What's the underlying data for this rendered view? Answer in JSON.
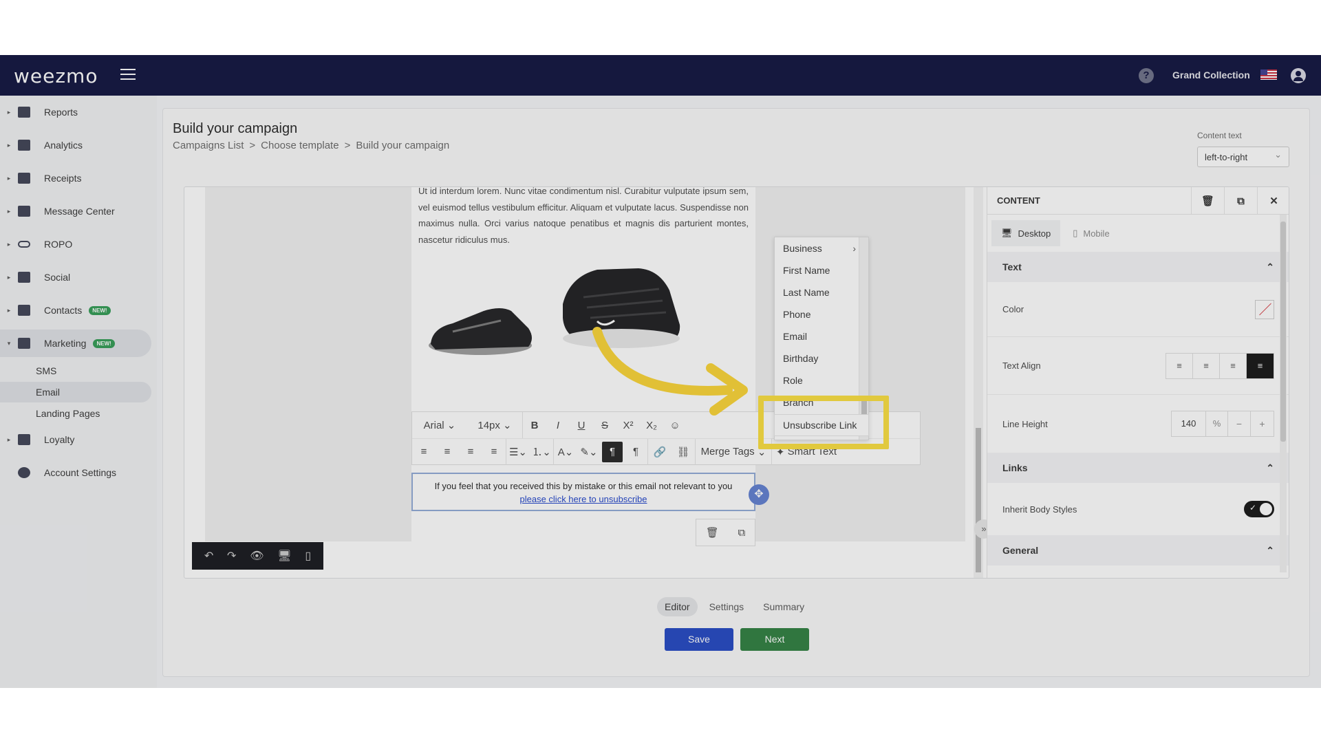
{
  "app": {
    "logo": "weezmo",
    "org_name": "Grand Collection"
  },
  "sidebar": {
    "items": [
      {
        "label": "Reports"
      },
      {
        "label": "Analytics"
      },
      {
        "label": "Receipts"
      },
      {
        "label": "Message Center"
      },
      {
        "label": "ROPO"
      },
      {
        "label": "Social"
      },
      {
        "label": "Contacts",
        "badge": "NEW!"
      },
      {
        "label": "Marketing",
        "badge": "NEW!"
      },
      {
        "label": "Loyalty"
      },
      {
        "label": "Account Settings"
      }
    ],
    "marketing_sub": [
      "SMS",
      "Email",
      "Landing Pages"
    ]
  },
  "page": {
    "title": "Build your campaign",
    "breadcrumb": [
      "Campaigns List",
      ">",
      "Choose template",
      ">",
      "Build your campaign"
    ],
    "content_text_label": "Content text",
    "content_text_value": "left-to-right"
  },
  "email": {
    "lorem": "Ut id interdum lorem. Nunc vitae condimentum nisl. Curabitur vulputate ipsum sem, vel euismod tellus vestibulum efficitur. Aliquam et vulputate lacus. Suspendisse non maximus nulla. Orci varius natoque penatibus et magnis dis parturient montes, nascetur ridiculus mus.",
    "footer_text": "If you feel that you received this by mistake or this email not relevant to you",
    "footer_link": "please click here to unsubscribe"
  },
  "toolbar": {
    "font": "Arial",
    "size": "14px",
    "merge_tags": "Merge Tags",
    "smart_text": "Smart Text"
  },
  "merge_menu": {
    "items": [
      "Business",
      "First Name",
      "Last Name",
      "Phone",
      "Email",
      "Birthday",
      "Role",
      "Branch"
    ],
    "highlighted": "Unsubscribe Link"
  },
  "panel": {
    "title": "CONTENT",
    "tabs": [
      "Desktop",
      "Mobile"
    ],
    "text_section": "Text",
    "color_label": "Color",
    "align_label": "Text Align",
    "line_height_label": "Line Height",
    "line_height_value": "140",
    "line_height_unit": "%",
    "links_section": "Links",
    "inherit_label": "Inherit Body Styles",
    "general_section": "General"
  },
  "steps": {
    "tabs": [
      "Editor",
      "Settings",
      "Summary"
    ],
    "save": "Save",
    "next": "Next"
  },
  "colors": {
    "topbar": "#0b0f3b",
    "save": "#1f45c2",
    "next": "#2b7d3c",
    "highlight": "#fbde3b"
  }
}
